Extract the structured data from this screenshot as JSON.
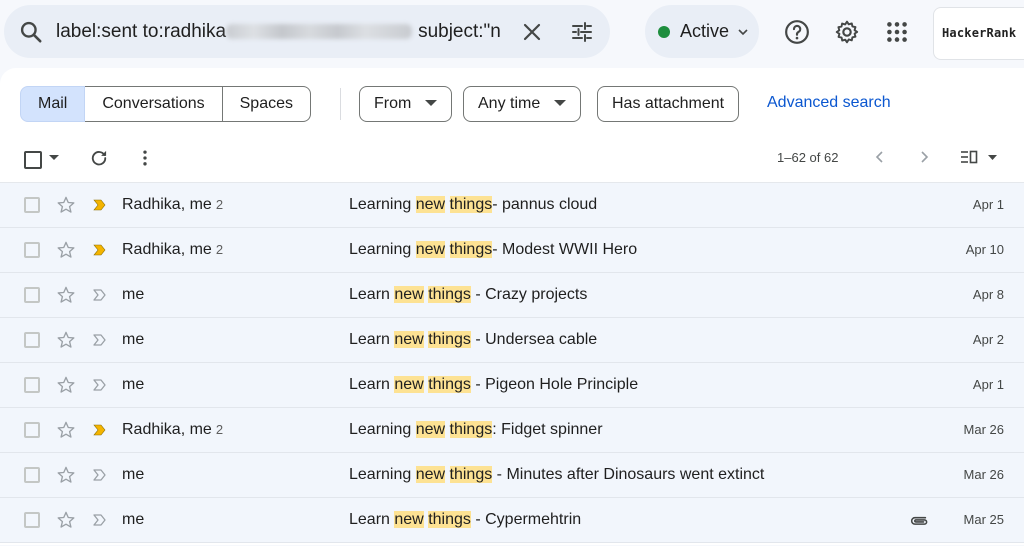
{
  "search": {
    "query_prefix": "label:sent to:radhika",
    "query_suffix": "subject:\"n"
  },
  "status": {
    "label": "Active",
    "color": "#1e8e3e"
  },
  "account": {
    "brand": "HackerRank"
  },
  "filters": {
    "segments": [
      "Mail",
      "Conversations",
      "Spaces"
    ],
    "from_label": "From",
    "time_label": "Any time",
    "attachment_label": "Has attachment",
    "advanced_label": "Advanced search"
  },
  "toolbar": {
    "count": "1–62 of 62"
  },
  "accent": "#0b57d0",
  "highlight": "#fde293",
  "emails": [
    {
      "sender": "Radhika, me",
      "count": "2",
      "important": true,
      "pre": "Learning ",
      "w1": "new",
      "w2": "things",
      "post": "- pannus cloud",
      "attach": false,
      "date": "Apr 1"
    },
    {
      "sender": "Radhika, me",
      "count": "2",
      "important": true,
      "pre": "Learning ",
      "w1": "new",
      "w2": "things",
      "post": "- Modest WWII Hero",
      "attach": false,
      "date": "Apr 10"
    },
    {
      "sender": "me",
      "count": "",
      "important": false,
      "pre": "Learn ",
      "w1": "new",
      "w2": "things",
      "post": " - Crazy projects",
      "attach": false,
      "date": "Apr 8"
    },
    {
      "sender": "me",
      "count": "",
      "important": false,
      "pre": "Learn ",
      "w1": "new",
      "w2": "things",
      "post": " - Undersea cable",
      "attach": false,
      "date": "Apr 2"
    },
    {
      "sender": "me",
      "count": "",
      "important": false,
      "pre": "Learn ",
      "w1": "new",
      "w2": "things",
      "post": " - Pigeon Hole Principle",
      "attach": false,
      "date": "Apr 1"
    },
    {
      "sender": "Radhika, me",
      "count": "2",
      "important": true,
      "pre": "Learning ",
      "w1": "new",
      "w2": "things",
      "post": ": Fidget spinner",
      "attach": false,
      "date": "Mar 26"
    },
    {
      "sender": "me",
      "count": "",
      "important": false,
      "pre": "Learning ",
      "w1": "new",
      "w2": "things",
      "post": " - Minutes after Dinosaurs went extinct",
      "attach": false,
      "date": "Mar 26"
    },
    {
      "sender": "me",
      "count": "",
      "important": false,
      "pre": "Learn ",
      "w1": "new",
      "w2": "things",
      "post": " - Cypermehtrin",
      "attach": true,
      "date": "Mar 25"
    }
  ]
}
